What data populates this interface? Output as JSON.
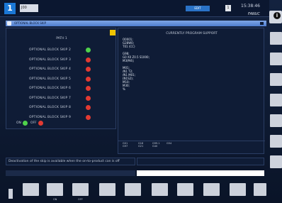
{
  "header": {
    "path_number": "1",
    "program": "J00",
    "mode": "EDIT",
    "channel": "1",
    "clock": "15:38:46",
    "brand": "FANUC"
  },
  "window": {
    "title": "OPTIONAL BLOCK SKIP"
  },
  "left_panel": {
    "title": "PATH 1",
    "items": [
      {
        "label": "OPTIONAL BLOCK SKIP 2",
        "state": "on"
      },
      {
        "label": "OPTIONAL BLOCK SKIP 3",
        "state": "off"
      },
      {
        "label": "OPTIONAL BLOCK SKIP 4",
        "state": "off"
      },
      {
        "label": "OPTIONAL BLOCK SKIP 5",
        "state": "off"
      },
      {
        "label": "OPTIONAL BLOCK SKIP 6",
        "state": "off"
      },
      {
        "label": "OPTIONAL BLOCK SKIP 7",
        "state": "off"
      },
      {
        "label": "OPTIONAL BLOCK SKIP 8",
        "state": "off"
      },
      {
        "label": "OPTIONAL BLOCK SKIP 9",
        "state": "off"
      }
    ],
    "on_label": "ON",
    "off_label": "OFF"
  },
  "right_panel": {
    "title": "CURRENTLY PROGRAM SUPPORT",
    "lines": [
      "O0001;",
      "G28W0;",
      "T01 (CC)",
      "",
      "G98;",
      "G0 X0 Z0.5 S1000;",
      "M3(M4);",
      "",
      "M01;",
      "/N1 T2;",
      "/N1 M01;",
      "(N1S2);",
      "M10;",
      "M30;",
      "%"
    ],
    "footer_cells": [
      "G01\nG97",
      "G18\nG21",
      "G99.1\nG40",
      "G54"
    ]
  },
  "message": {
    "text": "Deactivation of the skip is available when the on-to-product can is off"
  },
  "softkeys": {
    "labels": [
      "ON",
      "OFF"
    ]
  },
  "colors": {
    "on": "#4fd14b",
    "off": "#e23a32",
    "accent": "#1b78d6"
  }
}
